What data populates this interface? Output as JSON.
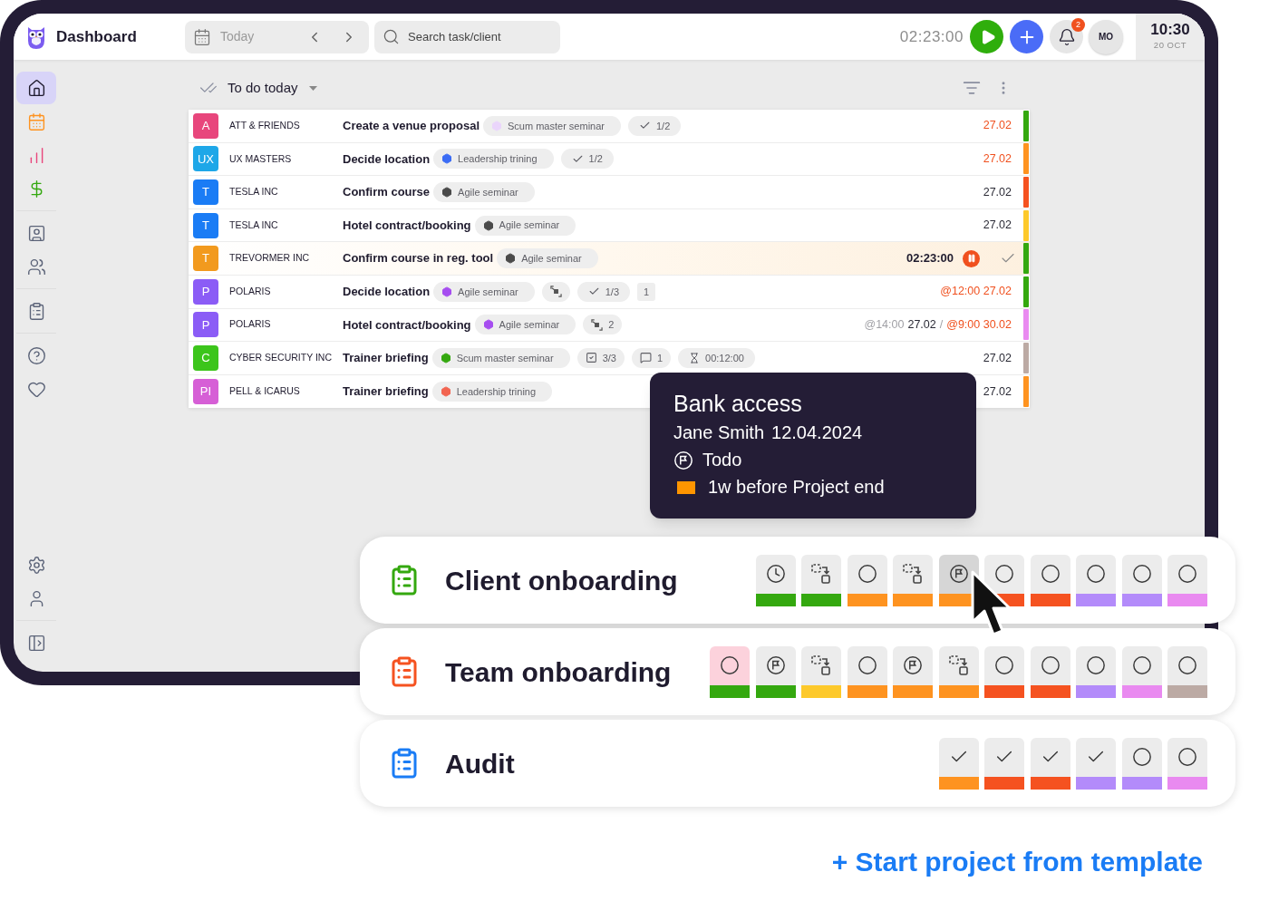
{
  "header": {
    "app_title": "Dashboard",
    "date_nav": {
      "label": "Today"
    },
    "search": {
      "placeholder": "Search task/client"
    },
    "timer": "02:23:00",
    "notifications": "2",
    "avatar": "MO",
    "clock": {
      "time": "10:30",
      "date": "20 OCT"
    }
  },
  "sidebar": {
    "top": [
      [
        {
          "selected": true
        },
        {
          "selected": false
        },
        {
          "selected": false
        },
        {
          "selected": false
        }
      ],
      [
        {
          "selected": false
        },
        {
          "selected": false
        }
      ],
      [
        {
          "selected": false
        }
      ],
      [
        {
          "selected": false
        },
        {
          "selected": false
        }
      ]
    ],
    "bottom": [
      [
        {
          "selected": false
        },
        {
          "selected": false
        }
      ],
      [
        {
          "selected": false
        }
      ]
    ]
  },
  "list": {
    "title": "To do today"
  },
  "rows": [
    {
      "avatar": {
        "initials": "A",
        "color": "#e8467c"
      },
      "client": "ATT & FRIENDS",
      "task": "Create a venue proposal",
      "tags": [
        {
          "kind": "project",
          "label": "Scum master seminar",
          "color": "#ead5fb"
        },
        {
          "kind": "checklist",
          "label": "1/2"
        }
      ],
      "due": [
        {
          "text": "27.02",
          "overdue": true,
          "muted": false
        }
      ],
      "stripe": {
        "color": "#34a80f"
      },
      "active": false
    },
    {
      "avatar": {
        "initials": "UX",
        "color": "#1ea7e8"
      },
      "client": "UX MASTERS",
      "task": "Decide location",
      "tags": [
        {
          "kind": "project",
          "label": "Leadership trining",
          "color": "#3b6cf5"
        },
        {
          "kind": "checklist",
          "label": "1/2"
        }
      ],
      "due": [
        {
          "text": "27.02",
          "overdue": true,
          "muted": false
        }
      ],
      "stripe": {
        "color": "#fe9320"
      },
      "active": false
    },
    {
      "avatar": {
        "initials": "T",
        "color": "#1a7cf5"
      },
      "client": "TESLA INC",
      "task": "Confirm course",
      "tags": [
        {
          "kind": "project",
          "label": "Agile seminar",
          "color": "#4a4a4a"
        }
      ],
      "due": [
        {
          "text": "27.02",
          "overdue": false,
          "muted": false
        }
      ],
      "stripe": {
        "color": "#f55220"
      },
      "active": false
    },
    {
      "avatar": {
        "initials": "T",
        "color": "#1a7cf5"
      },
      "client": "TESLA INC",
      "task": "Hotel contract/booking",
      "tags": [
        {
          "kind": "project",
          "label": "Agile seminar",
          "color": "#4a4a4a"
        }
      ],
      "due": [
        {
          "text": "27.02",
          "overdue": false,
          "muted": false
        }
      ],
      "stripe": {
        "color": "#fdc92b"
      },
      "active": false
    },
    {
      "avatar": {
        "initials": "T",
        "color": "#f29a1e"
      },
      "client": "TREVORMER INC",
      "task": "Confirm course in reg. tool",
      "tags": [
        {
          "kind": "project",
          "label": "Agile seminar",
          "color": "#4a4a4a"
        }
      ],
      "timer": "02:23:00",
      "stripe": {
        "color": "#34a80f"
      },
      "active": true
    },
    {
      "avatar": {
        "initials": "P",
        "color": "#8b5cf6"
      },
      "client": "POLARIS",
      "task": "Decide location",
      "tags": [
        {
          "kind": "project",
          "label": "Agile seminar",
          "color": "#a64df0"
        },
        {
          "kind": "subtasks"
        },
        {
          "kind": "checklist",
          "label": "1/3"
        },
        {
          "kind": "note",
          "label": "1"
        }
      ],
      "due": [
        {
          "text": "@12:00 27.02",
          "overdue": true,
          "muted": false
        }
      ],
      "stripe": {
        "color": "#34a80f"
      },
      "active": false
    },
    {
      "avatar": {
        "initials": "P",
        "color": "#8b5cf6"
      },
      "client": "POLARIS",
      "task": "Hotel contract/booking",
      "tags": [
        {
          "kind": "project",
          "label": "Agile seminar",
          "color": "#a64df0"
        },
        {
          "kind": "subtasks",
          "label": "2"
        }
      ],
      "due": [
        {
          "text": "@14:00",
          "overdue": false,
          "muted": true
        },
        {
          "text": "27.02",
          "overdue": false,
          "muted": false
        },
        {
          "text": "/",
          "overdue": false,
          "muted": true
        },
        {
          "text": "@9:00 30.02",
          "overdue": true,
          "muted": false
        }
      ],
      "stripe": {
        "color": "#e98af0"
      },
      "active": false
    },
    {
      "avatar": {
        "initials": "C",
        "color": "#3cc51b"
      },
      "client": "CYBER SECURITY INC",
      "task": "Trainer briefing",
      "tags": [
        {
          "kind": "project",
          "label": "Scum master seminar",
          "color": "#34a80f"
        },
        {
          "kind": "checkbox",
          "label": "3/3"
        },
        {
          "kind": "comment",
          "label": "1"
        },
        {
          "kind": "timer",
          "label": "00:12:00"
        }
      ],
      "due": [
        {
          "text": "27.02",
          "overdue": false,
          "muted": false
        }
      ],
      "stripe": {
        "color": "#bcaaa4"
      },
      "active": false
    },
    {
      "avatar": {
        "initials": "PI",
        "color": "#d65fd6"
      },
      "client": "PELL & ICARUS",
      "task": "Trainer briefing",
      "tags": [
        {
          "kind": "project",
          "label": "Leadership trining",
          "color": "#f26450"
        }
      ],
      "due": [
        {
          "text": "27.02",
          "overdue": false,
          "muted": false
        }
      ],
      "stripe": {
        "color": "#fe9320"
      },
      "active": false
    }
  ],
  "tooltip": {
    "title": "Bank access",
    "person": "Jane Smith",
    "date": "12.04.2024",
    "status": "Todo",
    "deadline": {
      "text": "1w before Project end",
      "color": "#ff9500"
    }
  },
  "templates": [
    {
      "name": "Client onboarding",
      "color": "#34a80f",
      "steps": [
        {
          "kind": "clock",
          "color": "#34a80f",
          "hovered": false,
          "alert": false
        },
        {
          "kind": "move",
          "color": "#34a80f",
          "hovered": false,
          "alert": false
        },
        {
          "kind": "circle",
          "color": "#fe9320",
          "hovered": false,
          "alert": false
        },
        {
          "kind": "move",
          "color": "#fe9320",
          "hovered": false,
          "alert": false
        },
        {
          "kind": "flag",
          "color": "#fe9320",
          "hovered": true,
          "alert": false
        },
        {
          "kind": "circle",
          "color": "#f55220",
          "hovered": false,
          "alert": false
        },
        {
          "kind": "circle",
          "color": "#f55220",
          "hovered": false,
          "alert": false
        },
        {
          "kind": "circle",
          "color": "#b38bfa",
          "hovered": false,
          "alert": false
        },
        {
          "kind": "circle",
          "color": "#b38bfa",
          "hovered": false,
          "alert": false
        },
        {
          "kind": "circle",
          "color": "#e98af0",
          "hovered": false,
          "alert": false
        }
      ]
    },
    {
      "name": "Team onboarding",
      "color": "#f55220",
      "steps": [
        {
          "kind": "circle",
          "color": "#34a80f",
          "hovered": false,
          "alert": true
        },
        {
          "kind": "flag",
          "color": "#34a80f",
          "hovered": false,
          "alert": false
        },
        {
          "kind": "move",
          "color": "#fdc92b",
          "hovered": false,
          "alert": false
        },
        {
          "kind": "circle",
          "color": "#fe9320",
          "hovered": false,
          "alert": false
        },
        {
          "kind": "flag",
          "color": "#fe9320",
          "hovered": false,
          "alert": false
        },
        {
          "kind": "move",
          "color": "#fe9320",
          "hovered": false,
          "alert": false
        },
        {
          "kind": "circle",
          "color": "#f55220",
          "hovered": false,
          "alert": false
        },
        {
          "kind": "circle",
          "color": "#f55220",
          "hovered": false,
          "alert": false
        },
        {
          "kind": "circle",
          "color": "#b38bfa",
          "hovered": false,
          "alert": false
        },
        {
          "kind": "circle",
          "color": "#e98af0",
          "hovered": false,
          "alert": false
        },
        {
          "kind": "circle",
          "color": "#bcaaa4",
          "hovered": false,
          "alert": false
        }
      ]
    },
    {
      "name": "Audit",
      "color": "#1a7cf5",
      "steps": [
        {
          "kind": "check",
          "color": "#fe9320",
          "hovered": false,
          "alert": false
        },
        {
          "kind": "check",
          "color": "#f55220",
          "hovered": false,
          "alert": false
        },
        {
          "kind": "check",
          "color": "#f55220",
          "hovered": false,
          "alert": false
        },
        {
          "kind": "check",
          "color": "#b38bfa",
          "hovered": false,
          "alert": false
        },
        {
          "kind": "circle",
          "color": "#b38bfa",
          "hovered": false,
          "alert": false
        },
        {
          "kind": "circle",
          "color": "#e98af0",
          "hovered": false,
          "alert": false
        }
      ]
    }
  ],
  "cta": "+ Start project from template"
}
